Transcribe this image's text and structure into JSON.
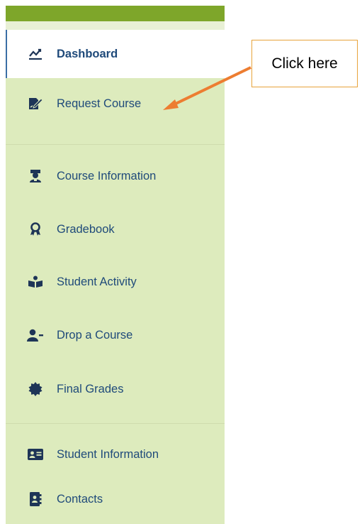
{
  "sidebar": {
    "items": [
      {
        "label": "Dashboard",
        "icon": "chart-line-icon",
        "active": true
      },
      {
        "label": "Request Course",
        "icon": "file-signature-icon"
      },
      {
        "label": "Course Information",
        "icon": "graduate-icon"
      },
      {
        "label": "Gradebook",
        "icon": "award-icon"
      },
      {
        "label": "Student Activity",
        "icon": "reading-person-icon"
      },
      {
        "label": "Drop a Course",
        "icon": "user-minus-icon"
      },
      {
        "label": "Final Grades",
        "icon": "certificate-badge-icon"
      },
      {
        "label": "Student Information",
        "icon": "id-card-icon"
      },
      {
        "label": "Contacts",
        "icon": "address-book-icon"
      }
    ]
  },
  "callout": {
    "text": "Click here"
  },
  "colors": {
    "topbar": "#7ea62a",
    "sidebar_bg": "#ddebbd",
    "label": "#1f4a7a",
    "icon": "#1e3557",
    "callout_border": "#e8a33b",
    "arrow": "#ed7d31"
  }
}
